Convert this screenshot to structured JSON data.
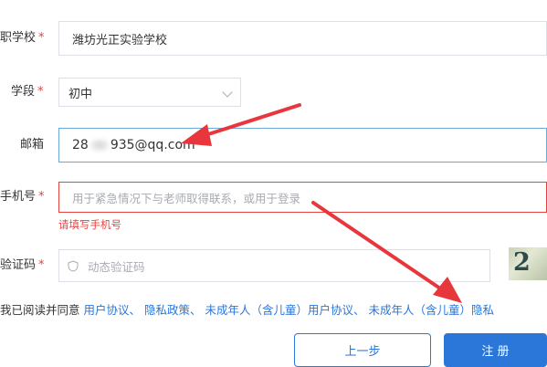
{
  "form": {
    "school": {
      "label": "职学校",
      "required_mark": "*",
      "value": "潍坊光正实验学校"
    },
    "stage": {
      "label": "学段",
      "required_mark": "*",
      "value": "初中"
    },
    "email": {
      "label": "邮箱",
      "value_prefix": "28",
      "value_suffix": "935@qq.com"
    },
    "phone": {
      "label": "手机号",
      "required_mark": "*",
      "placeholder": "用于紧急情况下与老师取得联系，或用于登录",
      "error": "请填写手机号"
    },
    "code": {
      "label": "验证码",
      "required_mark": "*",
      "placeholder": "动态验证码",
      "captcha_text": "2"
    }
  },
  "agreement": {
    "prefix": "我已阅读并同意",
    "links": [
      "用户协议、",
      "隐私政策、",
      "未成年人（含儿童）用户协议、",
      "未成年人（含儿童）隐私"
    ]
  },
  "buttons": {
    "prev": "上一步",
    "register": "注 册"
  },
  "colors": {
    "primary": "#2a76d9",
    "error": "#e64340",
    "annotation_arrow": "#e8373c"
  },
  "icons": {
    "code_field": "shield-icon",
    "stage_select": "chevron-down-icon"
  }
}
